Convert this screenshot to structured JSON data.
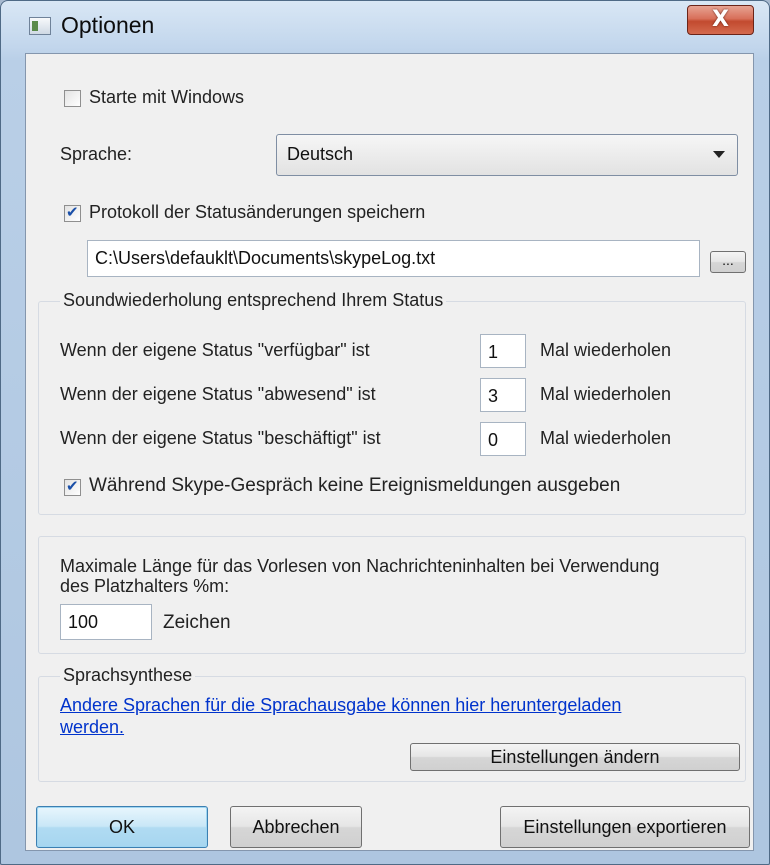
{
  "window": {
    "title": "Optionen",
    "close_label": "X"
  },
  "startup": {
    "label": "Starte mit Windows",
    "checked": false
  },
  "language": {
    "label": "Sprache:",
    "selected": "Deutsch"
  },
  "log": {
    "label": "Protokoll der Statusänderungen speichern",
    "checked": true,
    "path": "C:\\Users\\defauklt\\Documents\\skypeLog.txt",
    "browse_label": "..."
  },
  "sound": {
    "group_title": "Soundwiederholung entsprechend Ihrem Status",
    "rows": [
      {
        "label": "Wenn der eigene Status \"verfügbar\" ist",
        "value": "1",
        "suffix": "Mal wiederholen"
      },
      {
        "label": "Wenn der eigene Status \"abwesend\" ist",
        "value": "3",
        "suffix": "Mal wiederholen"
      },
      {
        "label": "Wenn der eigene Status \"beschäftigt\" ist",
        "value": "0",
        "suffix": "Mal wiederholen"
      }
    ],
    "no_events_label": "Während Skype-Gespräch keine Ereignismeldungen ausgeben",
    "no_events_checked": true
  },
  "maxlen": {
    "line1": "Maximale Länge für das Vorlesen von Nachrichteninhalten bei Verwendung",
    "line2": "des Platzhalters %m:",
    "value": "100",
    "unit": "Zeichen"
  },
  "tts": {
    "group_title": "Sprachsynthese",
    "link_line1": "Andere Sprachen für die Sprachausgabe können hier heruntergeladen",
    "link_line2": "werden.",
    "settings_button": "Einstellungen ändern"
  },
  "footer": {
    "ok": "OK",
    "cancel": "Abbrechen",
    "export": "Einstellungen exportieren"
  }
}
